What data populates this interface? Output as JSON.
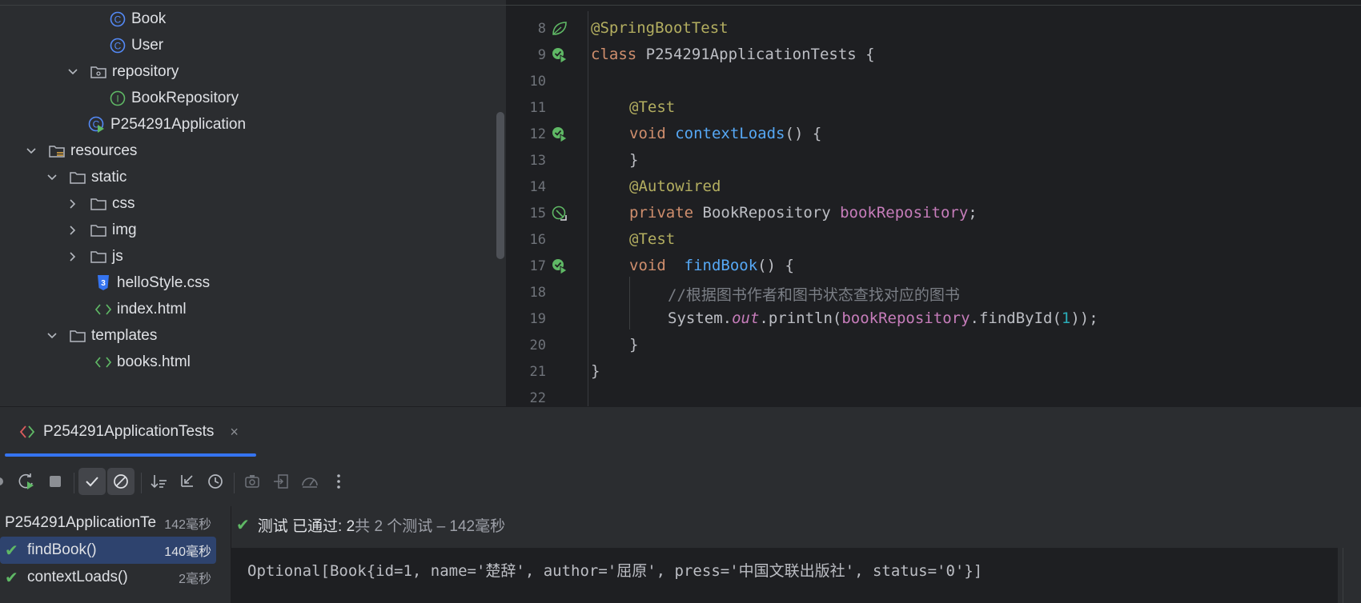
{
  "project_tree": {
    "items": [
      {
        "label": "Book",
        "icon": "class-icon"
      },
      {
        "label": "User",
        "icon": "class-icon"
      },
      {
        "label": "repository",
        "icon": "package-folder-icon"
      },
      {
        "label": "BookRepository",
        "icon": "interface-icon"
      },
      {
        "label": "P254291Application",
        "icon": "spring-app-class-icon"
      },
      {
        "label": "resources",
        "icon": "resources-folder-icon"
      },
      {
        "label": "static",
        "icon": "folder-icon"
      },
      {
        "label": "css",
        "icon": "folder-icon"
      },
      {
        "label": "img",
        "icon": "folder-icon"
      },
      {
        "label": "js",
        "icon": "folder-icon"
      },
      {
        "label": "helloStyle.css",
        "icon": "css-file-icon"
      },
      {
        "label": "index.html",
        "icon": "html-file-icon"
      },
      {
        "label": "templates",
        "icon": "folder-icon"
      },
      {
        "label": "books.html",
        "icon": "html-file-icon"
      }
    ]
  },
  "editor": {
    "line_numbers": [
      "8",
      "9",
      "10",
      "11",
      "12",
      "13",
      "14",
      "15",
      "16",
      "17",
      "18",
      "19",
      "20",
      "21",
      "22"
    ],
    "code": {
      "l8_ann": "@SpringBootTest",
      "l9_kw": "class",
      "l9_rest": " P254291ApplicationTests {",
      "l11_ann": "@Test",
      "l12_kw": "void",
      "l12_fn": "contextLoads",
      "l12_rest": "() {",
      "l13": "}",
      "l14_ann": "@Autowired",
      "l15_kw": "private",
      "l15_type": " BookRepository ",
      "l15_fld": "bookRepository",
      "l15_end": ";",
      "l16_ann": "@Test",
      "l17_kw": "void",
      "l17_fn": "findBook",
      "l17_rest": "() {",
      "l18_cmt": "//根据图书作者和图书状态查找对应的图书",
      "l19_a": "System.",
      "l19_out": "out",
      "l19_b": ".println(",
      "l19_fld": "bookRepository",
      "l19_c": ".findById(",
      "l19_num": "1",
      "l19_d": "));",
      "l20": "}",
      "l21": "}"
    }
  },
  "run_window": {
    "tab_label": "P254291ApplicationTests",
    "tab_close": "×",
    "toolbar_icons": [
      "rerun-icon",
      "rerun-failed-icon",
      "stop-icon",
      "show-passed-icon",
      "show-ignored-icon",
      "sort-icon",
      "collapse-icon",
      "history-icon",
      "screenshot-icon",
      "import-icon",
      "coverage-icon",
      "more-icon"
    ],
    "tests": [
      {
        "name": "P254291ApplicationTe",
        "time": "142毫秒",
        "status": "root"
      },
      {
        "name": "findBook()",
        "time": "140毫秒",
        "status": "passed"
      },
      {
        "name": "contextLoads()",
        "time": "2毫秒",
        "status": "passed"
      }
    ],
    "status": {
      "passed_text": "测试 已通过: 2",
      "rest_text": "共 2 个测试 – 142毫秒"
    },
    "console_output": "Optional[Book{id=1, name='楚辞', author='屈原', press='中国文联出版社', status='0'}]"
  },
  "colors": {
    "accent": "#3574f0",
    "pass_green": "#5fb865",
    "selection": "#2e436e"
  }
}
